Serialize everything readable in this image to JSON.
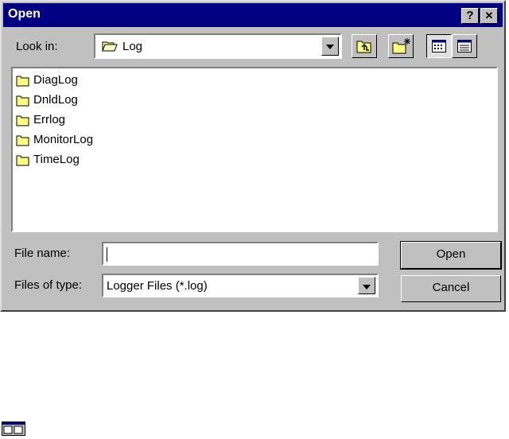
{
  "dialog": {
    "title": "Open",
    "help_label": "?",
    "close_label": "✕"
  },
  "look_in": {
    "label": "Look in:",
    "value": "Log"
  },
  "folders": [
    {
      "name": "DiagLog"
    },
    {
      "name": "DnldLog"
    },
    {
      "name": "Errlog"
    },
    {
      "name": "MonitorLog"
    },
    {
      "name": "TimeLog"
    }
  ],
  "file_name": {
    "label": "File name:",
    "value": ""
  },
  "files_of_type": {
    "label": "Files of type:",
    "value": "Logger Files (*.log)"
  },
  "buttons": {
    "open": "Open",
    "cancel": "Cancel"
  },
  "icons": {
    "folder_color": "#ffff80",
    "titlebar_color": "#000080"
  }
}
